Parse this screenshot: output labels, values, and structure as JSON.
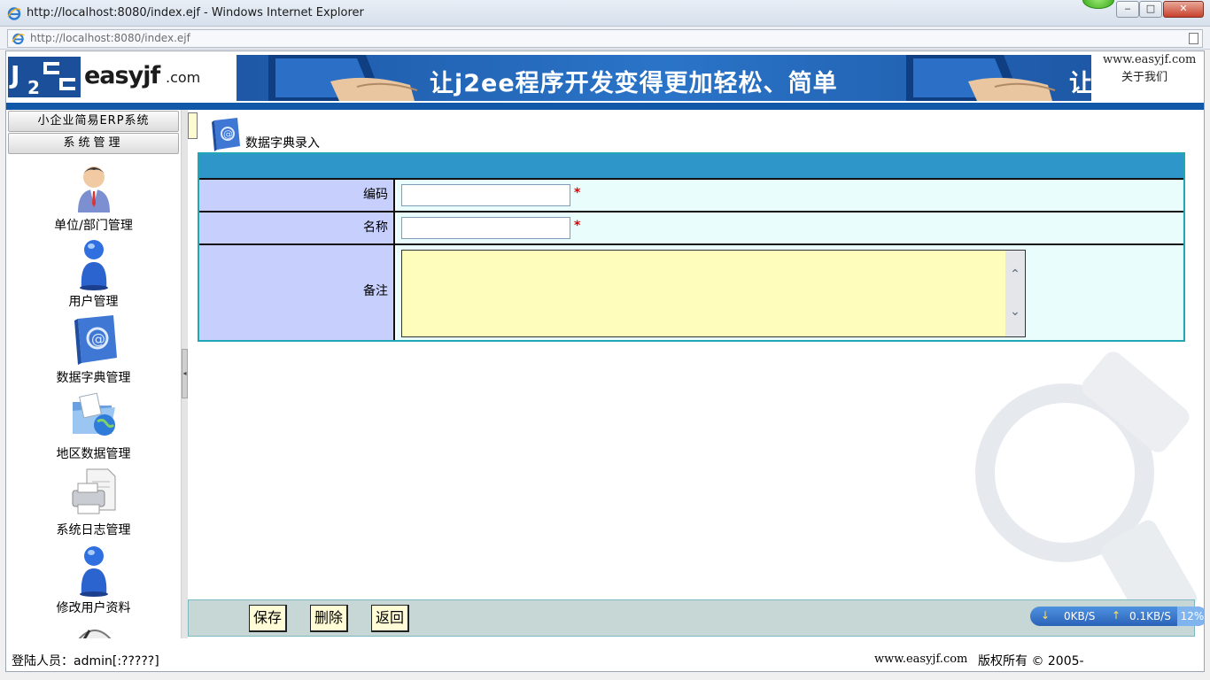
{
  "window": {
    "title": "http://localhost:8080/index.ejf - Windows Internet Explorer",
    "url": "http://localhost:8080/index.ejf",
    "controls": {
      "minimize": "‒",
      "maximize": "□",
      "close": "✕"
    }
  },
  "header": {
    "logo_blocks": "J2EE",
    "logo_brand": "easyjf",
    "logo_com": ".com",
    "banner_slogan": "让j2ee程序开发变得更加轻松、简单",
    "banner_slogan_cut": "让",
    "site": "www.easyjf.com",
    "about": "关于我们"
  },
  "sidebar": {
    "app_button": "小企业简易ERP系统",
    "section_button": "系统管理",
    "items": [
      {
        "label": "单位/部门管理",
        "icon": "manager-person-icon"
      },
      {
        "label": "用户管理",
        "icon": "user-icon"
      },
      {
        "label": "数据字典管理",
        "icon": "address-book-icon"
      },
      {
        "label": "地区数据管理",
        "icon": "folder-globe-icon"
      },
      {
        "label": "系统日志管理",
        "icon": "printer-log-icon"
      },
      {
        "label": "修改用户资料",
        "icon": "user-edit-icon"
      }
    ]
  },
  "page": {
    "title": "数据字典录入",
    "fields": {
      "code_label": "编码",
      "code_value": "",
      "name_label": "名称",
      "name_value": "",
      "remark_label": "备注",
      "remark_value": "",
      "required_mark": "*"
    },
    "toolbar": {
      "save": "保存",
      "delete": "删除",
      "back": "返回"
    }
  },
  "net_widget": {
    "download": "0KB/S",
    "upload": "0.1KB/S",
    "percent": "12%"
  },
  "footer": {
    "login": "登陆人员：admin[:?????]",
    "site": "www.easyjf.com",
    "copyright": "版权所有 © 2005-"
  },
  "colors": {
    "header_stripe": "#1159a8",
    "form_head": "#2e96c9",
    "label_bg": "#c7cffd",
    "value_bg": "#e9fdfd",
    "textarea_bg": "#fffdbb",
    "toolbar_bg": "#c7d7d6"
  }
}
